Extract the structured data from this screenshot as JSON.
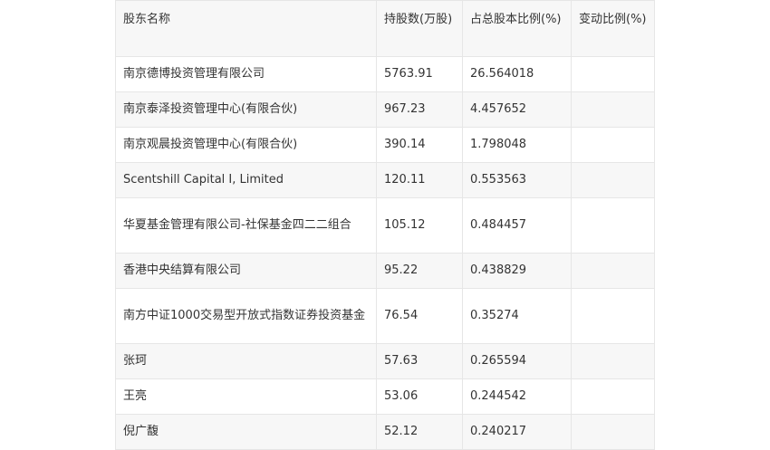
{
  "table": {
    "headers": [
      "股东名称",
      "持股数(万股)",
      "占总股本比例(%)",
      "变动比例(%)"
    ],
    "rows": [
      {
        "name": "南京德博投资管理有限公司",
        "shares": "5763.91",
        "ratio": "26.564018",
        "change": ""
      },
      {
        "name": "南京泰泽投资管理中心(有限合伙)",
        "shares": "967.23",
        "ratio": "4.457652",
        "change": ""
      },
      {
        "name": "南京观晨投资管理中心(有限合伙)",
        "shares": "390.14",
        "ratio": "1.798048",
        "change": ""
      },
      {
        "name": "Scentshill Capital I, Limited",
        "shares": "120.11",
        "ratio": "0.553563",
        "change": ""
      },
      {
        "name": "华夏基金管理有限公司-社保基金四二二组合",
        "shares": "105.12",
        "ratio": "0.484457",
        "change": ""
      },
      {
        "name": "香港中央结算有限公司",
        "shares": "95.22",
        "ratio": "0.438829",
        "change": ""
      },
      {
        "name": "南方中证1000交易型开放式指数证券投资基金",
        "shares": "76.54",
        "ratio": "0.35274",
        "change": ""
      },
      {
        "name": "张珂",
        "shares": "57.63",
        "ratio": "0.265594",
        "change": ""
      },
      {
        "name": "王亮",
        "shares": "53.06",
        "ratio": "0.244542",
        "change": ""
      },
      {
        "name": "倪广馥",
        "shares": "52.12",
        "ratio": "0.240217",
        "change": ""
      }
    ]
  }
}
